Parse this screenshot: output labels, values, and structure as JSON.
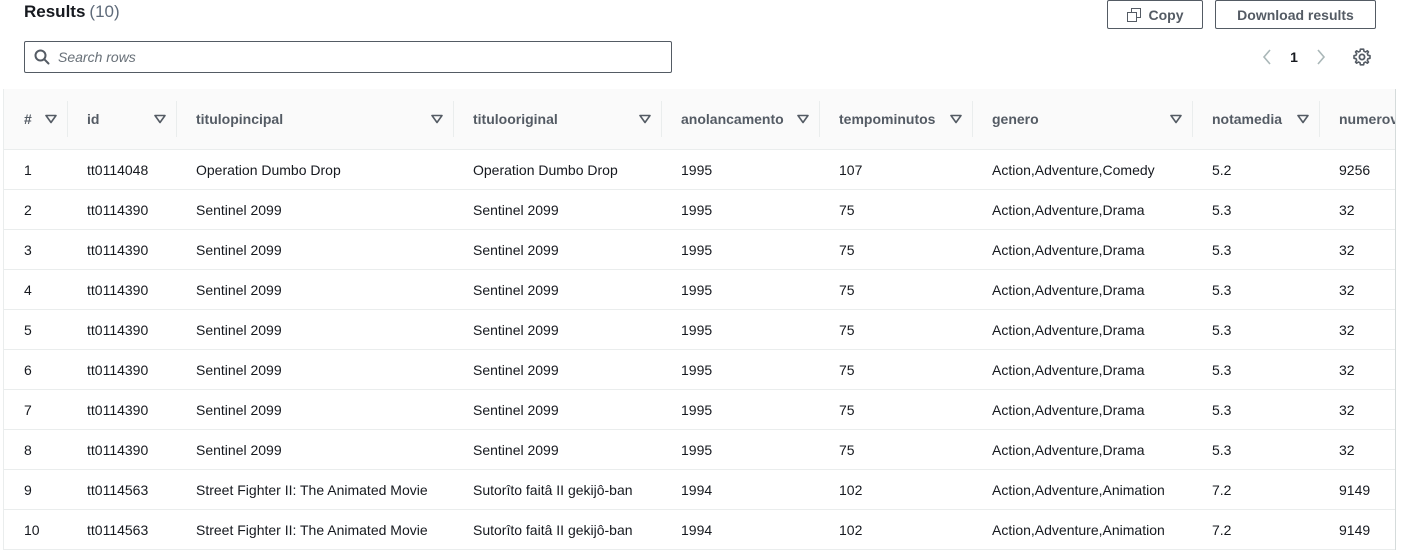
{
  "header": {
    "title": "Results",
    "count": "(10)"
  },
  "buttons": {
    "copy": "Copy",
    "download": "Download results"
  },
  "search": {
    "placeholder": "Search rows",
    "value": ""
  },
  "pagination": {
    "current_page": "1"
  },
  "table": {
    "columns": [
      "#",
      "id",
      "titulopincipal",
      "titulooriginal",
      "anolancamento",
      "tempominutos",
      "genero",
      "notamedia",
      "numerov"
    ],
    "rows": [
      [
        "1",
        "tt0114048",
        "Operation Dumbo Drop",
        "Operation Dumbo Drop",
        "1995",
        "107",
        "Action,Adventure,Comedy",
        "5.2",
        "9256"
      ],
      [
        "2",
        "tt0114390",
        "Sentinel 2099",
        "Sentinel 2099",
        "1995",
        "75",
        "Action,Adventure,Drama",
        "5.3",
        "32"
      ],
      [
        "3",
        "tt0114390",
        "Sentinel 2099",
        "Sentinel 2099",
        "1995",
        "75",
        "Action,Adventure,Drama",
        "5.3",
        "32"
      ],
      [
        "4",
        "tt0114390",
        "Sentinel 2099",
        "Sentinel 2099",
        "1995",
        "75",
        "Action,Adventure,Drama",
        "5.3",
        "32"
      ],
      [
        "5",
        "tt0114390",
        "Sentinel 2099",
        "Sentinel 2099",
        "1995",
        "75",
        "Action,Adventure,Drama",
        "5.3",
        "32"
      ],
      [
        "6",
        "tt0114390",
        "Sentinel 2099",
        "Sentinel 2099",
        "1995",
        "75",
        "Action,Adventure,Drama",
        "5.3",
        "32"
      ],
      [
        "7",
        "tt0114390",
        "Sentinel 2099",
        "Sentinel 2099",
        "1995",
        "75",
        "Action,Adventure,Drama",
        "5.3",
        "32"
      ],
      [
        "8",
        "tt0114390",
        "Sentinel 2099",
        "Sentinel 2099",
        "1995",
        "75",
        "Action,Adventure,Drama",
        "5.3",
        "32"
      ],
      [
        "9",
        "tt0114563",
        "Street Fighter II: The Animated Movie",
        "Sutorîto faitâ II gekijô-ban",
        "1994",
        "102",
        "Action,Adventure,Animation",
        "7.2",
        "9149"
      ],
      [
        "10",
        "tt0114563",
        "Street Fighter II: The Animated Movie",
        "Sutorîto faitâ II gekijô-ban",
        "1994",
        "102",
        "Action,Adventure,Animation",
        "7.2",
        "9149"
      ]
    ]
  },
  "icons": {
    "copy": "copy-icon",
    "search": "search-icon",
    "prev": "chevron-left-icon",
    "next": "chevron-right-icon",
    "settings": "gear-icon",
    "sort": "caret-down-icon"
  },
  "colors": {
    "text": "#16191f",
    "muted": "#5f6b7a",
    "border": "#545b64",
    "header_bg": "#fafafa",
    "divider": "#eaeded"
  }
}
